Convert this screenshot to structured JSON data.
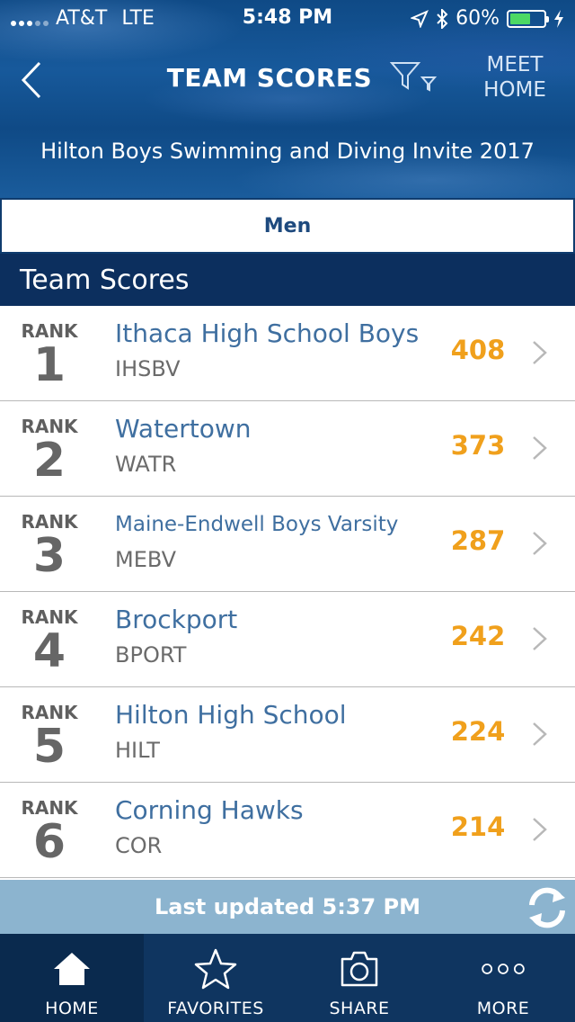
{
  "status_bar": {
    "carrier": "AT&T",
    "network": "LTE",
    "time": "5:48 PM",
    "battery_percent": "60%",
    "battery_level": 0.6
  },
  "nav": {
    "title": "TEAM SCORES",
    "meet_home_line1": "MEET",
    "meet_home_line2": "HOME",
    "back_icon": "chevron-left-icon",
    "filter_icon": "filter-icon"
  },
  "meet": {
    "name": "Hilton Boys Swimming and Diving Invite 2017"
  },
  "gender_tab": "Men",
  "section_title": "Team Scores",
  "rank_label": "RANK",
  "teams": [
    {
      "rank": "1",
      "name": "Ithaca High School Boys",
      "abbr": "IHSBV",
      "score": "408"
    },
    {
      "rank": "2",
      "name": "Watertown",
      "abbr": "WATR",
      "score": "373"
    },
    {
      "rank": "3",
      "name": "Maine-Endwell Boys Varsity",
      "abbr": "MEBV",
      "score": "287"
    },
    {
      "rank": "4",
      "name": "Brockport",
      "abbr": "BPORT",
      "score": "242"
    },
    {
      "rank": "5",
      "name": "Hilton High School",
      "abbr": "HILT",
      "score": "224"
    },
    {
      "rank": "6",
      "name": "Corning Hawks",
      "abbr": "COR",
      "score": "214"
    }
  ],
  "last_updated": "Last updated 5:37 PM",
  "tabs": [
    {
      "label": "HOME",
      "icon": "home-icon",
      "active": true
    },
    {
      "label": "FAVORITES",
      "icon": "star-icon",
      "active": false
    },
    {
      "label": "SHARE",
      "icon": "camera-icon",
      "active": false
    },
    {
      "label": "MORE",
      "icon": "more-icon",
      "active": false
    }
  ],
  "colors": {
    "header_blue": "#17599b",
    "section_navy": "#0c2f5e",
    "team_name_blue": "#3f6fa0",
    "score_orange": "#f0a01c",
    "updated_bar": "#8cb4cf",
    "tabbar": "#0f3560"
  }
}
